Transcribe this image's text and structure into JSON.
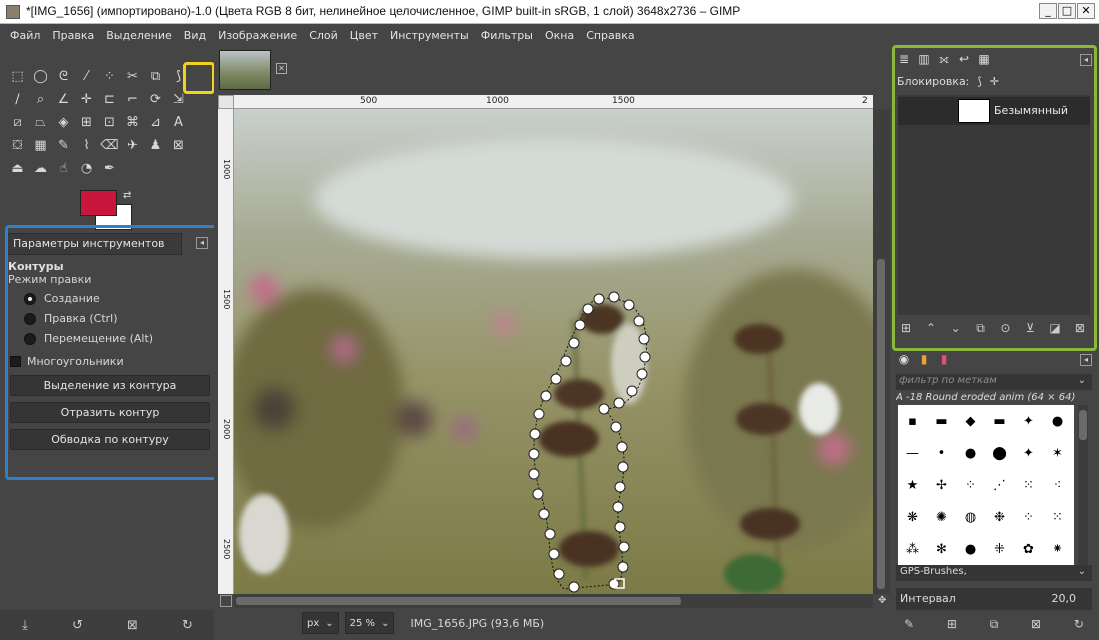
{
  "window": {
    "title": "*[IMG_1656] (импортировано)-1.0 (Цвета RGB 8 бит, нелинейное целочисленное, GIMP built-in sRGB, 1 слой) 3648x2736 – GIMP",
    "minimize": "_",
    "maximize": "□",
    "close": "✕"
  },
  "menu": [
    "Файл",
    "Правка",
    "Выделение",
    "Вид",
    "Изображение",
    "Слой",
    "Цвет",
    "Инструменты",
    "Фильтры",
    "Окна",
    "Справка"
  ],
  "toolbox": {
    "tools": [
      {
        "icon": "rect-select-icon",
        "glyph": "⬚"
      },
      {
        "icon": "ellipse-select-icon",
        "glyph": "◯"
      },
      {
        "icon": "lasso-icon",
        "glyph": "ᘓ"
      },
      {
        "icon": "fuzzy-select-icon",
        "glyph": "⁄"
      },
      {
        "icon": "select-by-color-icon",
        "glyph": "⁘"
      },
      {
        "icon": "scissors-icon",
        "glyph": "✂"
      },
      {
        "icon": "foreground-select-icon",
        "glyph": "⧉"
      },
      {
        "icon": "paths-tool-icon",
        "glyph": "⟆"
      },
      {
        "icon": "empty-icon",
        "glyph": ""
      },
      {
        "icon": "color-picker-icon",
        "glyph": "∕"
      },
      {
        "icon": "zoom-icon",
        "glyph": "⌕"
      },
      {
        "icon": "measure-icon",
        "glyph": "∠"
      },
      {
        "icon": "move-icon",
        "glyph": "✛"
      },
      {
        "icon": "align-icon",
        "glyph": "⊏"
      },
      {
        "icon": "crop-icon",
        "glyph": "⌐"
      },
      {
        "icon": "rotate-icon",
        "glyph": "⟳"
      },
      {
        "icon": "scale-icon",
        "glyph": "⇲"
      },
      {
        "icon": "empty-icon",
        "glyph": ""
      },
      {
        "icon": "shear-icon",
        "glyph": "⧄"
      },
      {
        "icon": "perspective-icon",
        "glyph": "⏢"
      },
      {
        "icon": "transform-3d-icon",
        "glyph": "◈"
      },
      {
        "icon": "unified-transform-icon",
        "glyph": "⊞"
      },
      {
        "icon": "handle-transform-icon",
        "glyph": "⊡"
      },
      {
        "icon": "warp-icon",
        "glyph": "⌘"
      },
      {
        "icon": "cage-icon",
        "glyph": "⊿"
      },
      {
        "icon": "text-icon",
        "glyph": "A"
      },
      {
        "icon": "empty-icon",
        "glyph": ""
      },
      {
        "icon": "bucket-fill-icon",
        "glyph": "⛋"
      },
      {
        "icon": "gradient-icon",
        "glyph": "▦"
      },
      {
        "icon": "pencil-icon",
        "glyph": "✎"
      },
      {
        "icon": "paintbrush-icon",
        "glyph": "⌇"
      },
      {
        "icon": "eraser-icon",
        "glyph": "⌫"
      },
      {
        "icon": "airbrush-icon",
        "glyph": "✈"
      },
      {
        "icon": "clone-icon",
        "glyph": "♟"
      },
      {
        "icon": "heal-icon",
        "glyph": "⊠"
      },
      {
        "icon": "empty-icon",
        "glyph": ""
      },
      {
        "icon": "perspective-clone-icon",
        "glyph": "⏏"
      },
      {
        "icon": "blur-icon",
        "glyph": "☁"
      },
      {
        "icon": "smudge-icon",
        "glyph": "☝"
      },
      {
        "icon": "dodge-icon",
        "glyph": "◔"
      },
      {
        "icon": "ink-icon",
        "glyph": "✒"
      }
    ],
    "fg_color": "#c8163c",
    "bg_color": "#ffffff",
    "swap": "⇄"
  },
  "tool_options": {
    "tab_label": "Параметры инструментов",
    "title": "Контуры",
    "edit_mode_label": "Режим правки",
    "modes": [
      {
        "label": "Создание",
        "selected": true
      },
      {
        "label": "Правка (Ctrl)",
        "selected": false
      },
      {
        "label": "Перемещение (Alt)",
        "selected": false
      }
    ],
    "polygons_label": "Многоугольники",
    "buttons": [
      "Выделение из контура",
      "Отразить контур",
      "Обводка по контуру"
    ]
  },
  "toolbox_bottom": [
    "⤓",
    "↺",
    "⊠",
    "↻"
  ],
  "canvas": {
    "ruler_h": [
      "500",
      "1000",
      "1500",
      "2"
    ],
    "ruler_v": [
      "1000",
      "1500",
      "2000",
      "2500"
    ],
    "unit": "px",
    "zoom": "25 %",
    "status": "IMG_1656.JPG (93,6 МБ)"
  },
  "layers": {
    "lock_label": "Блокировка:",
    "layer_name": "Безымянный",
    "bottom_buttons": [
      "⊞",
      "⌃",
      "⌄",
      "⧉",
      "⊙",
      "⊻",
      "◪",
      "⊠"
    ]
  },
  "brushes": {
    "filter_placeholder": "фильтр по меткам",
    "caption": "A -18 Round eroded anim (64 × 64)",
    "grid": [
      "▪",
      "▬",
      "◆",
      "▬",
      "✦",
      "●",
      "—",
      "•",
      "●",
      "⬤",
      "✦",
      "✶",
      "★",
      "✢",
      "⁘",
      "⋰",
      "⁙",
      "⁖",
      "❋",
      "✺",
      "◍",
      "❉",
      "⁘",
      "⁙",
      "⁂",
      "✻",
      "●",
      "⁜",
      "✿",
      "⁕"
    ],
    "selected_set": "GPS-Brushes,",
    "interval_label": "Интервал",
    "interval_value": "20,0",
    "bottom_buttons": [
      "✎",
      "⊞",
      "⧉",
      "⊠",
      "↻"
    ]
  },
  "colors": {
    "highlight_yellow": "#f0d31a",
    "frame_blue": "#2f80c8",
    "frame_green": "#8ab83a"
  }
}
